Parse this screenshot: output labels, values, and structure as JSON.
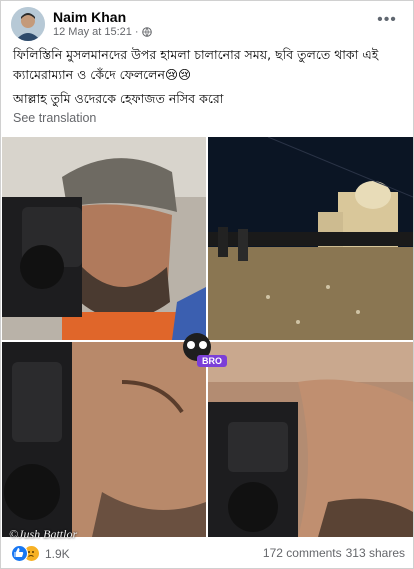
{
  "post": {
    "author": "Naim Khan",
    "timestamp": "12 May at 15:21",
    "separator": "·",
    "more_label": "•••",
    "text_line1": "ফিলিস্তিনি মুসলমানদের উপর হামলা চালানোর সময়, ছবি তুলতে থাকা এই ক্যামেরাম্যান ও কেঁদে ফেললেন😢😢",
    "text_line2": "আল্লাহ তুমি ওদেরকে হেফাজত নসিব করো",
    "see_translation": "See translation"
  },
  "image": {
    "badge_text": "BRO",
    "watermark": "©Jush Battlor"
  },
  "footer": {
    "reaction_count": "1.9K",
    "comments": "172 comments",
    "shares": "313 shares"
  },
  "colors": {
    "like_blue": "#1877f2",
    "sad_yellow": "#f7b125",
    "meta_gray": "#65676b"
  },
  "icons": [
    "avatar",
    "globe-icon",
    "more-icon",
    "like-reaction-icon",
    "sad-reaction-icon"
  ]
}
